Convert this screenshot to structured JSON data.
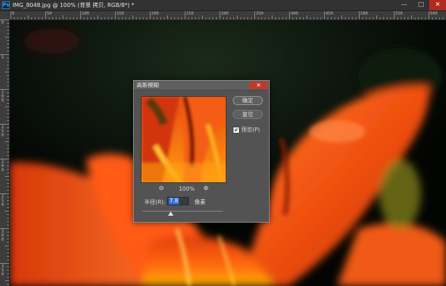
{
  "window": {
    "app_icon": "Ps",
    "title": "IMG_8048.jpg @ 100% (背景 拷贝, RGB/8*) *",
    "controls": {
      "minimize": "—",
      "maximize": "□",
      "close": "✕"
    }
  },
  "ruler": {
    "top_labels": [
      "0",
      "50",
      "100",
      "150",
      "200",
      "250",
      "300",
      "350",
      "400",
      "450",
      "500",
      "550",
      "600"
    ],
    "left_labels": [
      "0",
      "5",
      "1\n0\n0",
      "1\n5\n0",
      "2\n0\n0",
      "2\n5\n0",
      "3\n0\n0",
      "3\n5\n0",
      "4\n0\n0"
    ]
  },
  "dialog": {
    "title": "高斯模糊",
    "close_glyph": "✕",
    "ok_label": "确定",
    "reset_label": "复位",
    "preview_label": "预览(P)",
    "preview_checked": true,
    "zoom_out_glyph": "⊖",
    "zoom_in_glyph": "⊕",
    "zoom_level": "100%",
    "radius_label": "半径(R):",
    "radius_value": "7.8",
    "unit_label": "像素",
    "accent_color": "#2f6fd1"
  },
  "icons": [
    "photoshop-app-icon",
    "zoom-out-icon",
    "zoom-in-icon",
    "close-icon",
    "checkbox-icon",
    "slider-thumb-icon"
  ]
}
